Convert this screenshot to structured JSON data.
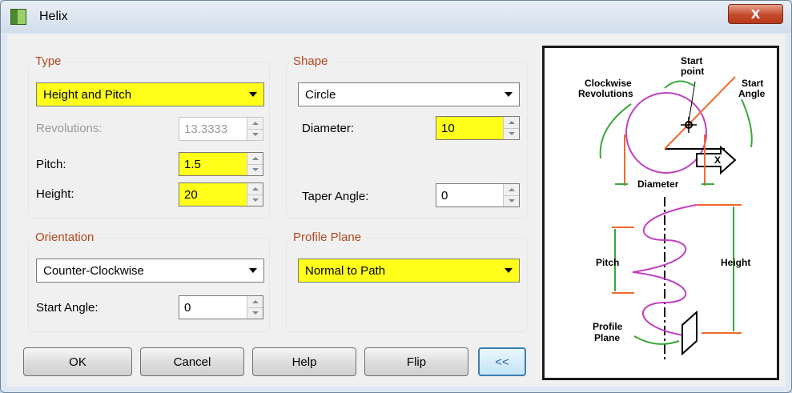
{
  "window": {
    "title": "Helix",
    "close_label": "X"
  },
  "type_group": {
    "title": "Type",
    "selected": "Height and Pitch",
    "revolutions_label": "Revolutions:",
    "revolutions_value": "13.3333",
    "pitch_label": "Pitch:",
    "pitch_value": "1.5",
    "height_label": "Height:",
    "height_value": "20"
  },
  "shape_group": {
    "title": "Shape",
    "selected": "Circle",
    "diameter_label": "Diameter:",
    "diameter_value": "10",
    "taper_label": "Taper Angle:",
    "taper_value": "0"
  },
  "orientation_group": {
    "title": "Orientation",
    "selected": "Counter-Clockwise",
    "start_angle_label": "Start Angle:",
    "start_angle_value": "0"
  },
  "profile_group": {
    "title": "Profile Plane",
    "selected": "Normal to Path"
  },
  "buttons": {
    "ok": "OK",
    "cancel": "Cancel",
    "help": "Help",
    "flip": "Flip",
    "collapse": "<<"
  },
  "diagram": {
    "clockwise_line1": "Clockwise",
    "clockwise_line2": "Revolutions",
    "start_point_line1": "Start",
    "start_point_line2": "point",
    "start_angle_line1": "Start",
    "start_angle_line2": "Angle",
    "diameter": "Diameter",
    "pitch": "Pitch",
    "height": "Height",
    "profile_line1": "Profile",
    "profile_line2": "Plane",
    "axis": "X"
  },
  "colors": {
    "highlight": "#ffff1a",
    "group_title": "#b2471c",
    "accent_orange": "#ef6a2c",
    "accent_green": "#3aa83a",
    "accent_purple": "#c040c0"
  }
}
